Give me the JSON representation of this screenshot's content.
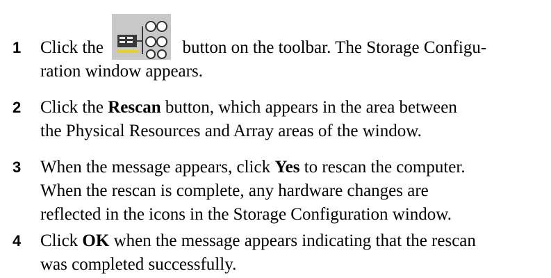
{
  "steps": [
    {
      "number": "1",
      "line1_before": "Click the",
      "line1_after": "button on the toolbar. The Storage Configu-",
      "line2": "ration window appears."
    },
    {
      "number": "2",
      "line1_before": "Click the ",
      "line1_bold": "Rescan",
      "line1_after": " button, which appears in the area between",
      "line2": "the Physical Resources and Array areas of the window."
    },
    {
      "number": "3",
      "line1_before": "When the message appears, click ",
      "line1_bold": "Yes",
      "line1_after": " to rescan the computer.",
      "line2": "When the rescan is complete, any hardware changes are",
      "line3": "reflected in the icons in the Storage Configuration window."
    },
    {
      "number": "4",
      "line1_before": "Click ",
      "line1_bold": "OK",
      "line1_after": " when the message appears indicating that the rescan",
      "line2": "was completed successfully."
    }
  ],
  "toolbar_icon": "storage-configuration-icon"
}
